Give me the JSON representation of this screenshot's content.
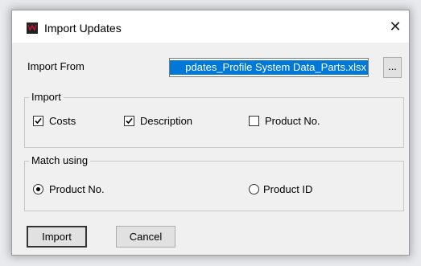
{
  "window": {
    "title": "Import Updates",
    "close_glyph": "✕",
    "app_icon": "red-w-logo-icon"
  },
  "import_from": {
    "label": "Import From",
    "value": "pdates_Profile System Data_Parts.xlsx",
    "browse_label": "..."
  },
  "import_group": {
    "legend": "Import",
    "options": [
      {
        "label": "Costs",
        "checked": true
      },
      {
        "label": "Description",
        "checked": true
      },
      {
        "label": "Product No.",
        "checked": false
      }
    ]
  },
  "match_group": {
    "legend": "Match using",
    "options": [
      {
        "label": "Product No.",
        "selected": true
      },
      {
        "label": "Product ID",
        "selected": false
      }
    ]
  },
  "buttons": {
    "import_label": "Import",
    "cancel_label": "Cancel"
  },
  "colors": {
    "selection": "#0078d7",
    "app_icon": "#c8102e"
  }
}
